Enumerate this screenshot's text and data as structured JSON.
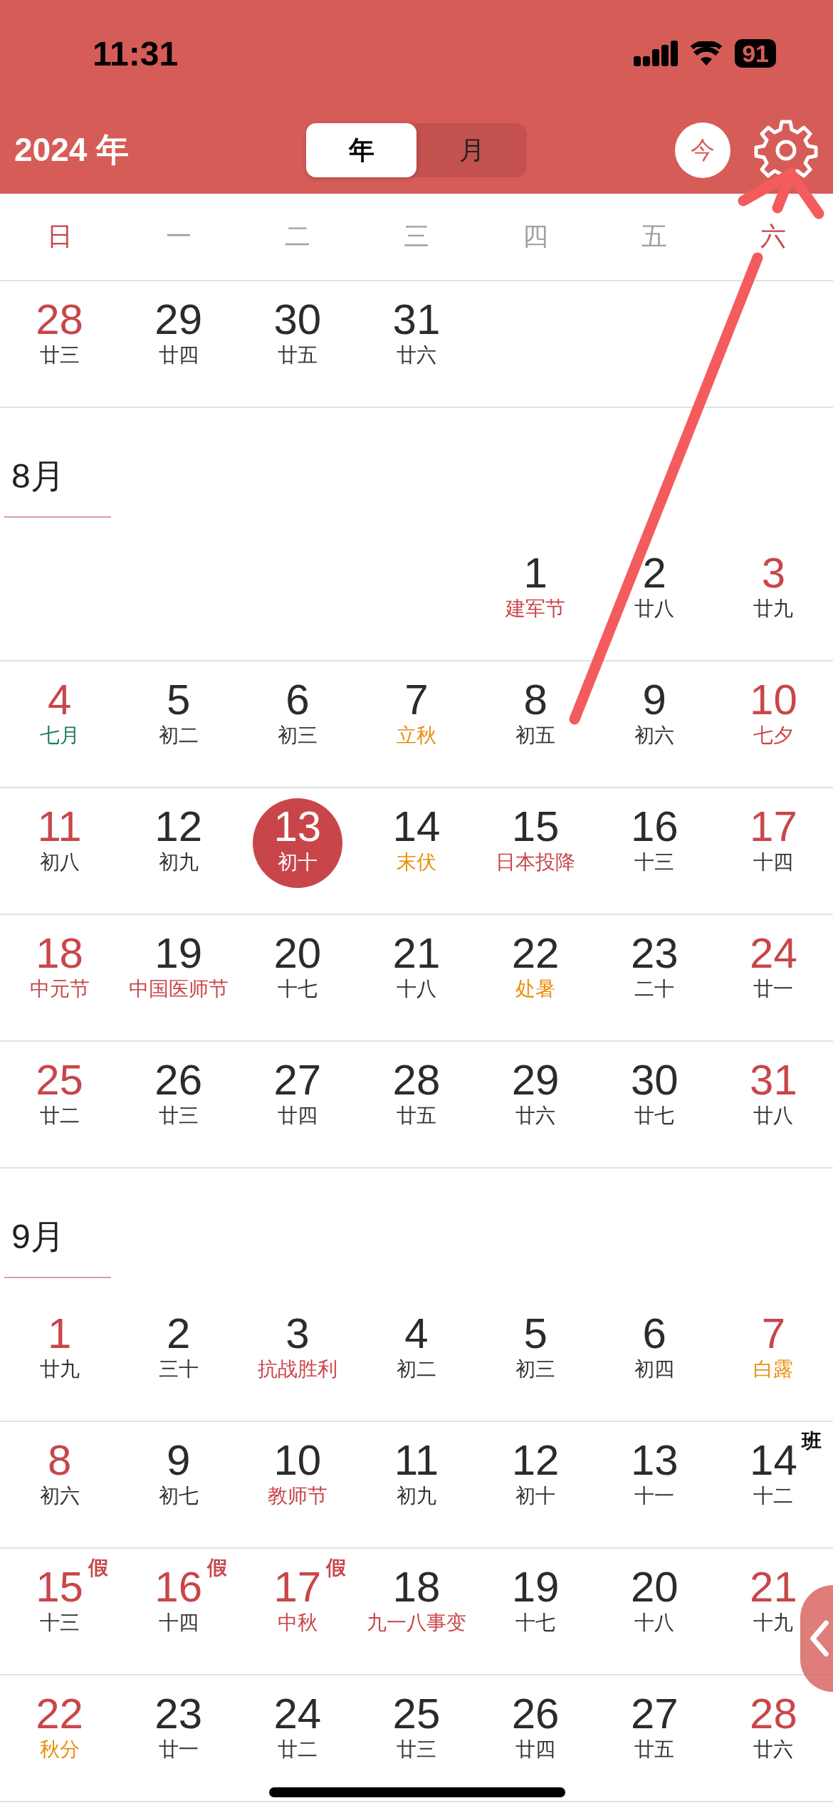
{
  "status_bar": {
    "time": "11:31",
    "battery": "91"
  },
  "header": {
    "year": "2024 年",
    "tabs": [
      {
        "label": "年",
        "selected": true
      },
      {
        "label": "月",
        "selected": false
      }
    ],
    "today_button": "今"
  },
  "weekdays": [
    {
      "label": "日",
      "weekend": true
    },
    {
      "label": "一",
      "weekend": false
    },
    {
      "label": "二",
      "weekend": false
    },
    {
      "label": "三",
      "weekend": false
    },
    {
      "label": "四",
      "weekend": false
    },
    {
      "label": "五",
      "weekend": false
    },
    {
      "label": "六",
      "weekend": true
    }
  ],
  "sections": [
    {
      "weeks": [
        {
          "right_aligned": false,
          "days": [
            {
              "day": "28",
              "lunar": "廿三",
              "day_off": true,
              "kind": "lunar",
              "selected": false
            },
            {
              "day": "29",
              "lunar": "廿四",
              "day_off": false,
              "kind": "lunar",
              "selected": false
            },
            {
              "day": "30",
              "lunar": "廿五",
              "day_off": false,
              "kind": "lunar",
              "selected": false
            },
            {
              "day": "31",
              "lunar": "廿六",
              "day_off": false,
              "kind": "lunar",
              "selected": false
            }
          ]
        }
      ]
    },
    {
      "month": "8月",
      "weeks": [
        {
          "right_aligned": true,
          "days": [
            {
              "day": "1",
              "lunar": "建军节",
              "day_off": false,
              "kind": "festival",
              "selected": false
            },
            {
              "day": "2",
              "lunar": "廿八",
              "day_off": false,
              "kind": "lunar",
              "selected": false
            },
            {
              "day": "3",
              "lunar": "廿九",
              "day_off": true,
              "kind": "lunar",
              "selected": false
            }
          ]
        },
        {
          "days": [
            {
              "day": "4",
              "lunar": "七月",
              "day_off": true,
              "kind": "month",
              "selected": false
            },
            {
              "day": "5",
              "lunar": "初二",
              "day_off": false,
              "kind": "lunar",
              "selected": false
            },
            {
              "day": "6",
              "lunar": "初三",
              "day_off": false,
              "kind": "lunar",
              "selected": false
            },
            {
              "day": "7",
              "lunar": "立秋",
              "day_off": false,
              "kind": "term",
              "selected": false
            },
            {
              "day": "8",
              "lunar": "初五",
              "day_off": false,
              "kind": "lunar",
              "selected": false
            },
            {
              "day": "9",
              "lunar": "初六",
              "day_off": false,
              "kind": "lunar",
              "selected": false
            },
            {
              "day": "10",
              "lunar": "七夕",
              "day_off": true,
              "kind": "festival",
              "selected": false
            }
          ]
        },
        {
          "days": [
            {
              "day": "11",
              "lunar": "初八",
              "day_off": true,
              "kind": "lunar",
              "selected": false
            },
            {
              "day": "12",
              "lunar": "初九",
              "day_off": false,
              "kind": "lunar",
              "selected": false
            },
            {
              "day": "13",
              "lunar": "初十",
              "day_off": false,
              "kind": "lunar",
              "selected": true
            },
            {
              "day": "14",
              "lunar": "末伏",
              "day_off": false,
              "kind": "term",
              "selected": false
            },
            {
              "day": "15",
              "lunar": "日本投降",
              "day_off": false,
              "kind": "festival",
              "selected": false
            },
            {
              "day": "16",
              "lunar": "十三",
              "day_off": false,
              "kind": "lunar",
              "selected": false
            },
            {
              "day": "17",
              "lunar": "十四",
              "day_off": true,
              "kind": "lunar",
              "selected": false
            }
          ]
        },
        {
          "days": [
            {
              "day": "18",
              "lunar": "中元节",
              "day_off": true,
              "kind": "festival",
              "selected": false
            },
            {
              "day": "19",
              "lunar": "中国医师节",
              "day_off": false,
              "kind": "festival",
              "selected": false
            },
            {
              "day": "20",
              "lunar": "十七",
              "day_off": false,
              "kind": "lunar",
              "selected": false
            },
            {
              "day": "21",
              "lunar": "十八",
              "day_off": false,
              "kind": "lunar",
              "selected": false
            },
            {
              "day": "22",
              "lunar": "处暑",
              "day_off": false,
              "kind": "term",
              "selected": false
            },
            {
              "day": "23",
              "lunar": "二十",
              "day_off": false,
              "kind": "lunar",
              "selected": false
            },
            {
              "day": "24",
              "lunar": "廿一",
              "day_off": true,
              "kind": "lunar",
              "selected": false
            }
          ]
        },
        {
          "days": [
            {
              "day": "25",
              "lunar": "廿二",
              "day_off": true,
              "kind": "lunar",
              "selected": false
            },
            {
              "day": "26",
              "lunar": "廿三",
              "day_off": false,
              "kind": "lunar",
              "selected": false
            },
            {
              "day": "27",
              "lunar": "廿四",
              "day_off": false,
              "kind": "lunar",
              "selected": false
            },
            {
              "day": "28",
              "lunar": "廿五",
              "day_off": false,
              "kind": "lunar",
              "selected": false
            },
            {
              "day": "29",
              "lunar": "廿六",
              "day_off": false,
              "kind": "lunar",
              "selected": false
            },
            {
              "day": "30",
              "lunar": "廿七",
              "day_off": false,
              "kind": "lunar",
              "selected": false
            },
            {
              "day": "31",
              "lunar": "廿八",
              "day_off": true,
              "kind": "lunar",
              "selected": false
            }
          ]
        }
      ]
    },
    {
      "month": "9月",
      "weeks": [
        {
          "days": [
            {
              "day": "1",
              "lunar": "廿九",
              "day_off": true,
              "kind": "lunar",
              "selected": false
            },
            {
              "day": "2",
              "lunar": "三十",
              "day_off": false,
              "kind": "lunar",
              "selected": false
            },
            {
              "day": "3",
              "lunar": "抗战胜利",
              "day_off": false,
              "kind": "festival",
              "selected": false
            },
            {
              "day": "4",
              "lunar": "初二",
              "day_off": false,
              "kind": "lunar",
              "selected": false
            },
            {
              "day": "5",
              "lunar": "初三",
              "day_off": false,
              "kind": "lunar",
              "selected": false
            },
            {
              "day": "6",
              "lunar": "初四",
              "day_off": false,
              "kind": "lunar",
              "selected": false
            },
            {
              "day": "7",
              "lunar": "白露",
              "day_off": true,
              "kind": "term",
              "selected": false
            }
          ]
        },
        {
          "days": [
            {
              "day": "8",
              "lunar": "初六",
              "day_off": true,
              "kind": "lunar",
              "selected": false
            },
            {
              "day": "9",
              "lunar": "初七",
              "day_off": false,
              "kind": "lunar",
              "selected": false
            },
            {
              "day": "10",
              "lunar": "教师节",
              "day_off": false,
              "kind": "festival",
              "selected": false
            },
            {
              "day": "11",
              "lunar": "初九",
              "day_off": false,
              "kind": "lunar",
              "selected": false
            },
            {
              "day": "12",
              "lunar": "初十",
              "day_off": false,
              "kind": "lunar",
              "selected": false
            },
            {
              "day": "13",
              "lunar": "十一",
              "day_off": false,
              "kind": "lunar",
              "selected": false
            },
            {
              "day": "14",
              "lunar": "十二",
              "day_off": false,
              "kind": "lunar",
              "selected": false,
              "badge": "班"
            }
          ]
        },
        {
          "days": [
            {
              "day": "15",
              "lunar": "十三",
              "day_off": true,
              "kind": "lunar",
              "selected": false,
              "badge": "假"
            },
            {
              "day": "16",
              "lunar": "十四",
              "day_off": true,
              "kind": "lunar",
              "selected": false,
              "badge": "假"
            },
            {
              "day": "17",
              "lunar": "中秋",
              "day_off": true,
              "kind": "festival",
              "selected": false,
              "badge": "假"
            },
            {
              "day": "18",
              "lunar": "九一八事变",
              "day_off": false,
              "kind": "festival",
              "selected": false
            },
            {
              "day": "19",
              "lunar": "十七",
              "day_off": false,
              "kind": "lunar",
              "selected": false
            },
            {
              "day": "20",
              "lunar": "十八",
              "day_off": false,
              "kind": "lunar",
              "selected": false
            },
            {
              "day": "21",
              "lunar": "十九",
              "day_off": true,
              "kind": "lunar",
              "selected": false
            }
          ]
        },
        {
          "days": [
            {
              "day": "22",
              "lunar": "秋分",
              "day_off": true,
              "kind": "term",
              "selected": false
            },
            {
              "day": "23",
              "lunar": "廿一",
              "day_off": false,
              "kind": "lunar",
              "selected": false
            },
            {
              "day": "24",
              "lunar": "廿二",
              "day_off": false,
              "kind": "lunar",
              "selected": false
            },
            {
              "day": "25",
              "lunar": "廿三",
              "day_off": false,
              "kind": "lunar",
              "selected": false
            },
            {
              "day": "26",
              "lunar": "廿四",
              "day_off": false,
              "kind": "lunar",
              "selected": false
            },
            {
              "day": "27",
              "lunar": "廿五",
              "day_off": false,
              "kind": "lunar",
              "selected": false
            },
            {
              "day": "28",
              "lunar": "廿六",
              "day_off": true,
              "kind": "lunar",
              "selected": false
            }
          ]
        }
      ]
    }
  ]
}
